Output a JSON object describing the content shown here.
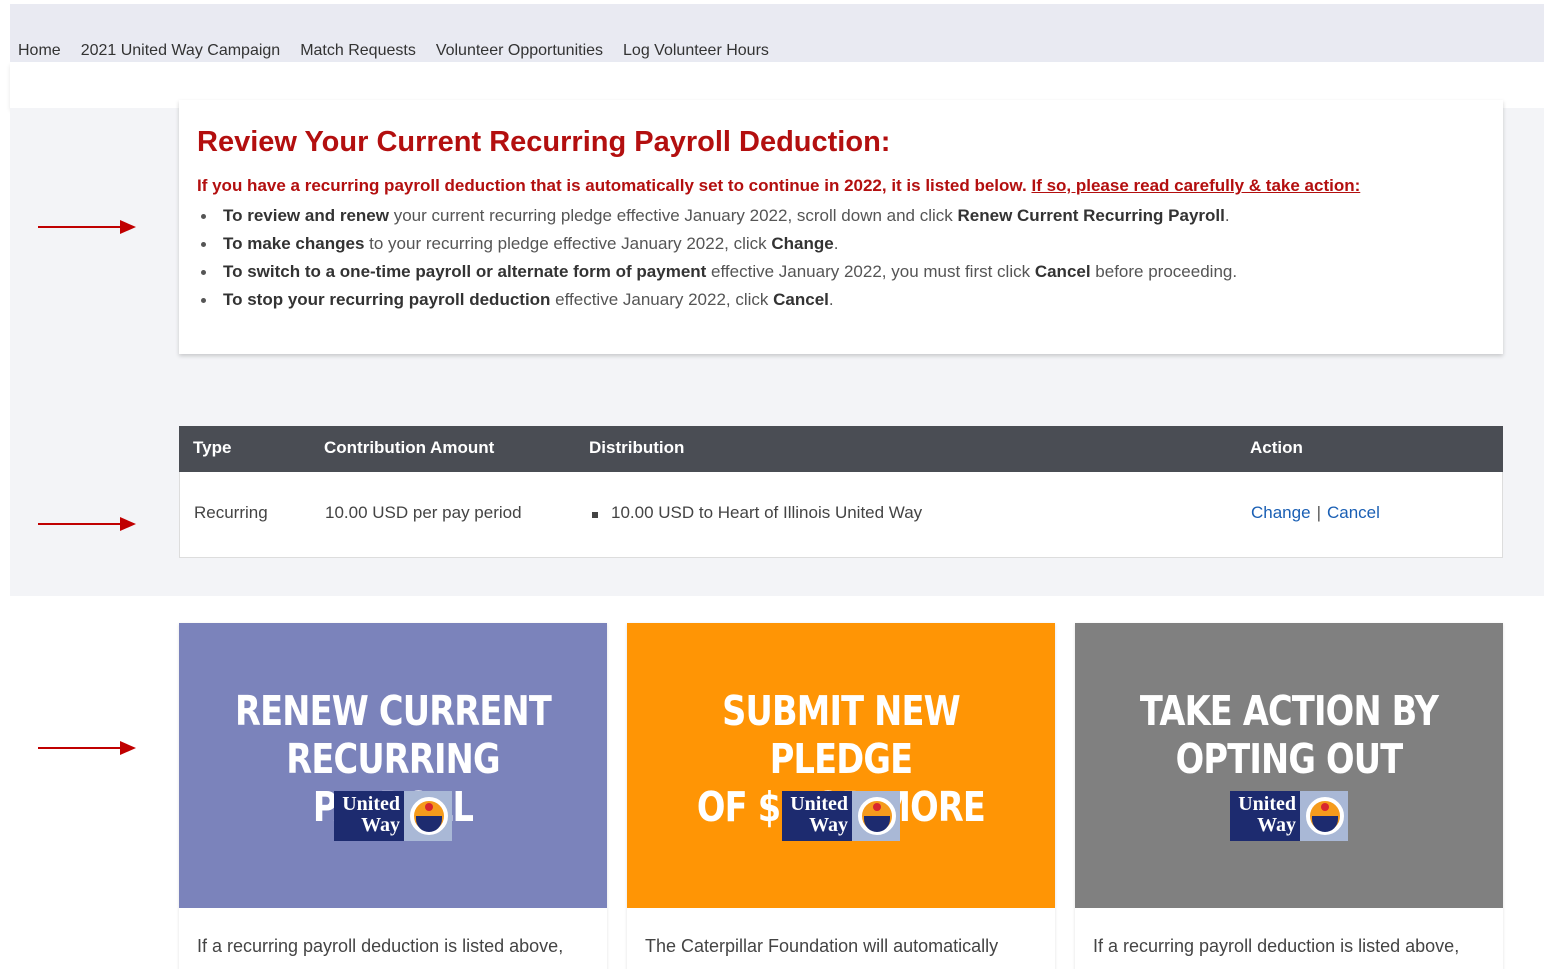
{
  "nav": {
    "items": [
      "Home",
      "2021 United Way Campaign",
      "Match Requests",
      "Volunteer Opportunities",
      "Log Volunteer Hours"
    ],
    "active_index": 1
  },
  "review": {
    "title": "Review Your Current Recurring Payroll Deduction:",
    "intro": "If you have a recurring payroll deduction that is automatically set to continue in 2022, it is listed below.",
    "intro_link": "If so, please read carefully & take action:",
    "bullets": [
      {
        "bold": "To review and renew",
        "text": " your current recurring pledge effective January 2022, scroll down and click ",
        "bold2": "Renew Current Recurring Payroll",
        "tail": "."
      },
      {
        "bold": "To make changes",
        "text": " to your recurring pledge effective January 2022, click ",
        "bold2": "Change",
        "tail": "."
      },
      {
        "bold": "To switch to a one-time payroll or alternate form of payment",
        "text": " effective January 2022, you must first click ",
        "bold2": "Cancel",
        "tail": " before proceeding."
      },
      {
        "bold": "To stop your recurring payroll deduction",
        "text": " effective January 2022, click ",
        "bold2": "Cancel",
        "tail": "."
      }
    ]
  },
  "table": {
    "headers": [
      "Type",
      "Contribution Amount",
      "Distribution",
      "Action"
    ],
    "row": {
      "type": "Recurring",
      "amount": "10.00 USD per pay period",
      "distribution": "10.00 USD to Heart of Illinois United Way",
      "change_label": "Change",
      "separator": "|",
      "cancel_label": "Cancel"
    }
  },
  "tiles": [
    {
      "line1": "RENEW CURRENT",
      "line2": "RECURRING PAYROLL",
      "bg": "#7b83bb",
      "logo_top": "United",
      "logo_bottom": "Way",
      "text": "If a recurring payroll deduction is listed above,"
    },
    {
      "line1": "SUBMIT NEW PLEDGE",
      "line2": "OF $1 OR MORE",
      "bg": "#ff9505",
      "logo_top": "United",
      "logo_bottom": "Way",
      "text": "The Caterpillar Foundation will automatically"
    },
    {
      "line1": "TAKE ACTION BY",
      "line2": "OPTING OUT",
      "bg": "#808080",
      "logo_top": "United",
      "logo_bottom": "Way",
      "text": "If a recurring payroll deduction is listed above,"
    }
  ],
  "colors": {
    "accent_red": "#b30f0f",
    "arrow_red": "#c00000",
    "table_header": "#4a4d54",
    "link_blue": "#1a5fb4"
  }
}
